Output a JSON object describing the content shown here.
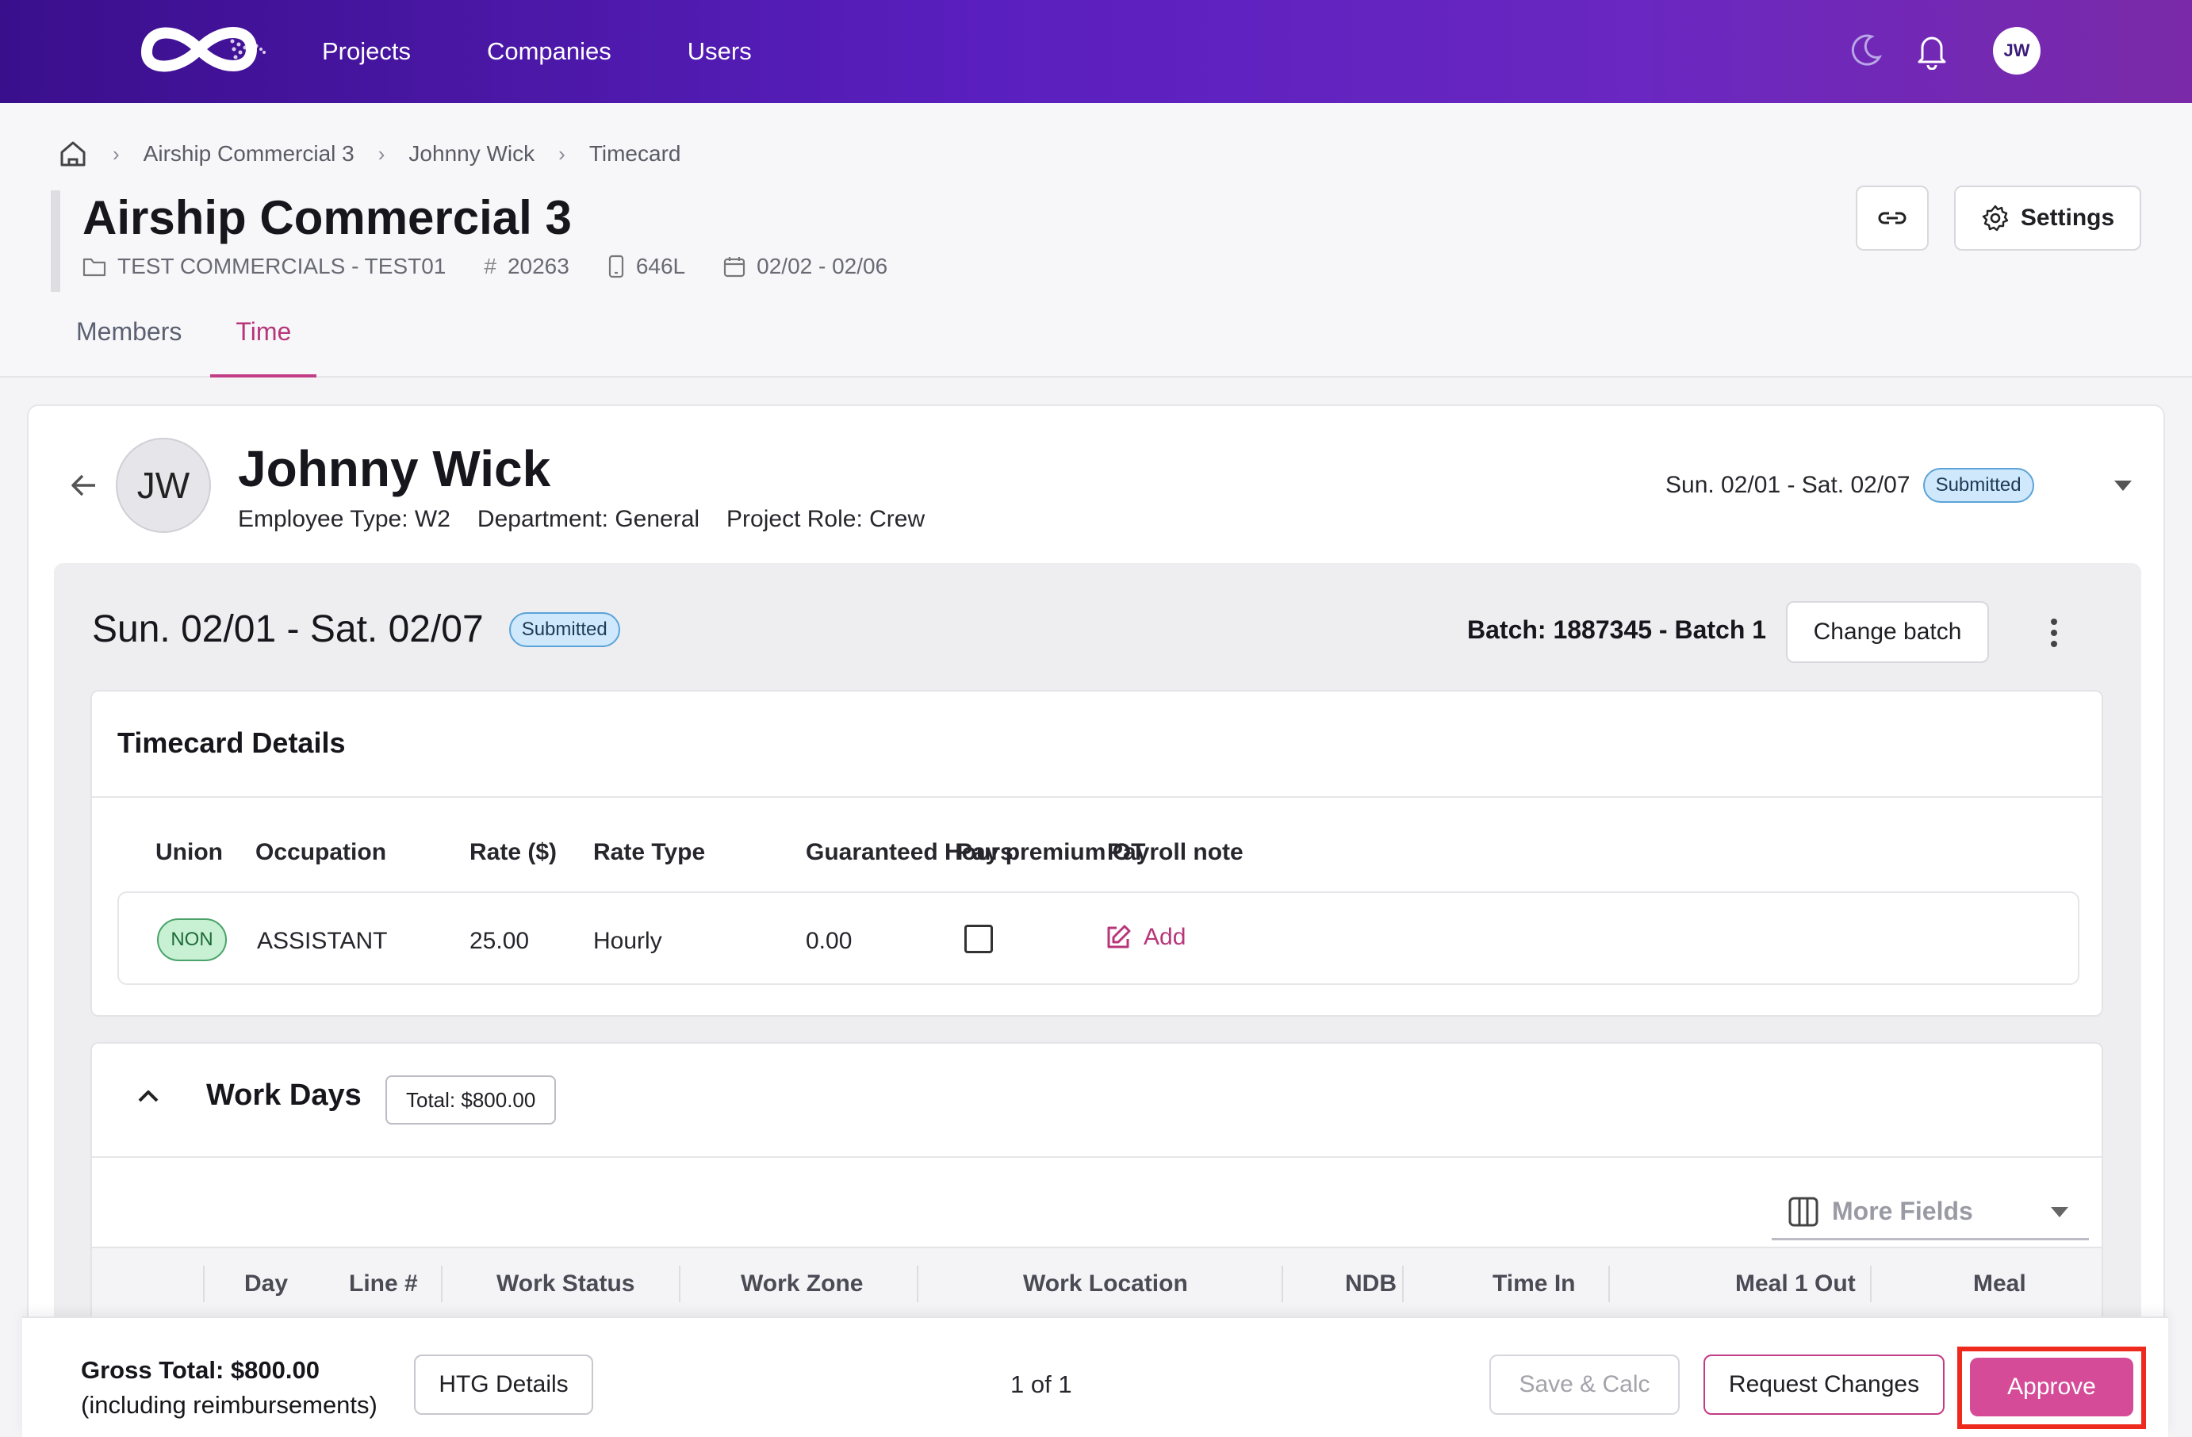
{
  "nav": {
    "links": [
      "Projects",
      "Companies",
      "Users"
    ],
    "avatar_initials": "JW",
    "icons": [
      "logo",
      "moon-icon",
      "bell-icon"
    ]
  },
  "breadcrumb": [
    "Airship Commercial 3",
    "Johnny Wick",
    "Timecard"
  ],
  "project": {
    "title": "Airship Commercial 3",
    "company": "TEST COMMERCIALS - TEST01",
    "number": "20263",
    "code": "646L",
    "dates": "02/02 - 02/06"
  },
  "header_buttons": {
    "settings": "Settings"
  },
  "tabs": [
    {
      "label": "Members",
      "active": false
    },
    {
      "label": "Time",
      "active": true
    }
  ],
  "employee": {
    "initials": "JW",
    "name": "Johnny Wick",
    "employee_type": "Employee Type: W2",
    "department": "Department: General",
    "project_role": "Project Role: Crew",
    "week_selector": "Sun. 02/01 - Sat. 02/07",
    "status": "Submitted"
  },
  "timecard": {
    "range": "Sun. 02/01 - Sat. 02/07",
    "status": "Submitted",
    "batch": "Batch: 1887345 - Batch 1",
    "change_batch": "Change batch"
  },
  "details": {
    "title": "Timecard Details",
    "headers": [
      "Union",
      "Occupation",
      "Rate ($)",
      "Rate Type",
      "Guaranteed Hours",
      "Pay premium OT",
      "Payroll note"
    ],
    "row": {
      "union": "NON",
      "occupation": "ASSISTANT",
      "rate": "25.00",
      "rate_type": "Hourly",
      "guaranteed_hours": "0.00",
      "pay_premium_ot": false,
      "payroll_note_action": "Add"
    }
  },
  "work_days": {
    "title": "Work Days",
    "total": "Total: $800.00",
    "more_fields": "More Fields",
    "columns": [
      "Day",
      "Line #",
      "Work Status",
      "Work Zone",
      "Work Location",
      "NDB",
      "Time In",
      "Meal 1 Out",
      "Meal"
    ]
  },
  "footer": {
    "gross_total": "Gross Total: $800.00",
    "gross_note": "(including reimbursements)",
    "htg_details": "HTG Details",
    "pager": "1 of 1",
    "save_calc": "Save & Calc",
    "request_changes": "Request Changes",
    "approve": "Approve"
  },
  "colors": {
    "accent": "#c23c86",
    "approve": "#d64b98",
    "highlight": "#ee2a1e",
    "nav_start": "#3a0f8c",
    "nav_end": "#7a2aa8"
  }
}
